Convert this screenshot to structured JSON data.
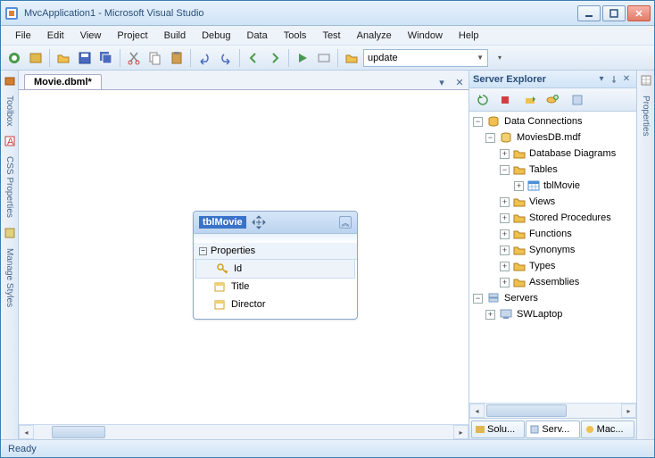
{
  "window": {
    "title": "MvcApplication1 - Microsoft Visual Studio"
  },
  "menu": {
    "file": "File",
    "edit": "Edit",
    "view": "View",
    "project": "Project",
    "build": "Build",
    "debug": "Debug",
    "data": "Data",
    "tools": "Tools",
    "test": "Test",
    "analyze": "Analyze",
    "window": "Window",
    "help": "Help"
  },
  "toolbar": {
    "config_value": "update"
  },
  "document": {
    "tab_title": "Movie.dbml*"
  },
  "entity": {
    "name": "tblMovie",
    "section": "Properties",
    "fields": {
      "id": "Id",
      "title": "Title",
      "director": "Director"
    }
  },
  "side_tabs": {
    "toolbox": "Toolbox",
    "css": "CSS Properties",
    "styles": "Manage Styles",
    "props": "Properties"
  },
  "server_explorer": {
    "title": "Server Explorer",
    "data_connections": "Data Connections",
    "db": "MoviesDB.mdf",
    "db_diagrams": "Database Diagrams",
    "tables": "Tables",
    "tbl": "tblMovie",
    "views": "Views",
    "sprocs": "Stored Procedures",
    "functions": "Functions",
    "synonyms": "Synonyms",
    "types": "Types",
    "assemblies": "Assemblies",
    "servers": "Servers",
    "server1": "SWLaptop"
  },
  "bottom_tabs": {
    "solution": "Solu...",
    "server": "Serv...",
    "macro": "Mac..."
  },
  "status": {
    "text": "Ready"
  }
}
